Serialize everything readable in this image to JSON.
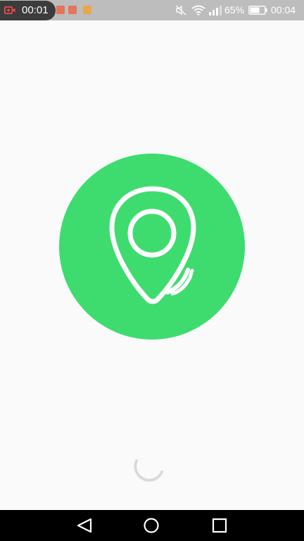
{
  "status_bar": {
    "recording_time": "00:01",
    "battery_percent": "65%",
    "clock": "00:04",
    "icons": [
      "screen-record-icon",
      "notification-icon",
      "notification-icon",
      "notification-icon",
      "mute-icon",
      "wifi-icon",
      "signal-icon",
      "battery-icon"
    ]
  },
  "splash": {
    "logo_icon": "location-pin-icon",
    "loading_indicator": "spinner-icon"
  },
  "nav_bar": {
    "icons": [
      "back-icon",
      "home-icon",
      "recents-icon"
    ]
  },
  "colors": {
    "status_bar_bg": "#bdbdbd",
    "page_bg": "#fafafa",
    "logo_green": "#3edc6e",
    "spinner_gray": "#d9d9d9",
    "nav_bar_bg": "#000000"
  }
}
